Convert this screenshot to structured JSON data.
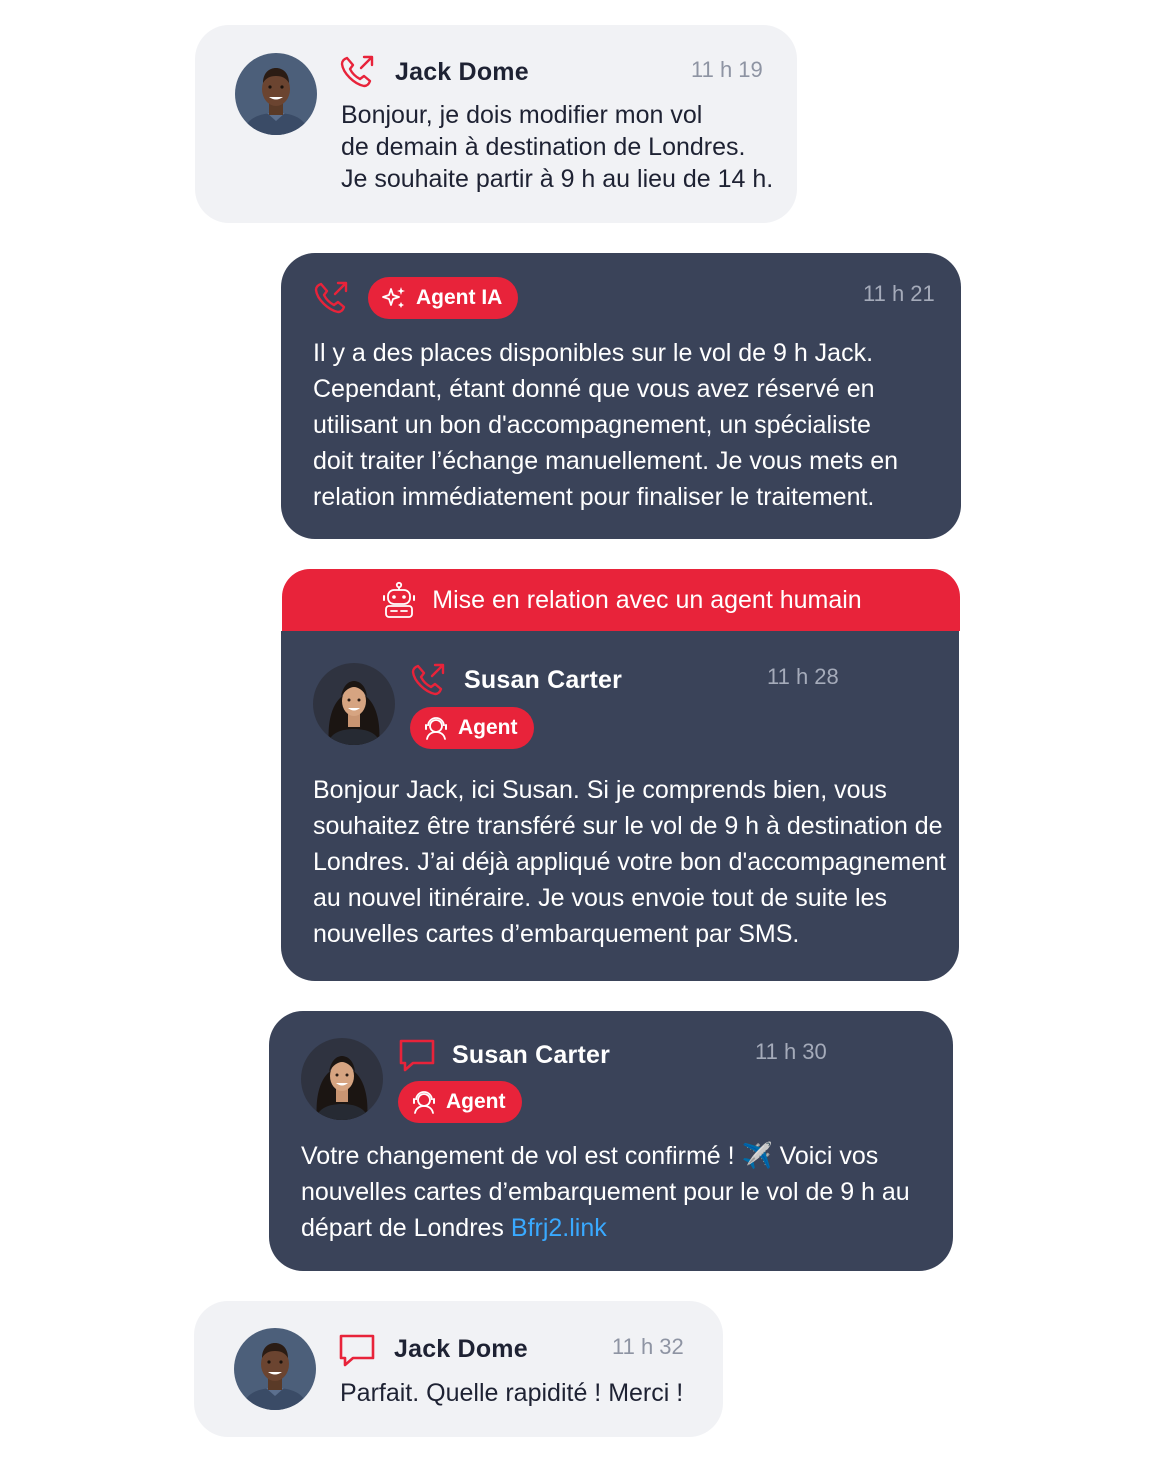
{
  "conversation": {
    "messages": [
      {
        "sender": "Jack Dome",
        "channel_icon": "phone-call-icon",
        "time": "11 h 19",
        "lines": [
          "Bonjour, je dois modifier mon vol",
          "de demain à destination de Londres.",
          "Je souhaite partir à 9 h au lieu de 14 h."
        ]
      },
      {
        "channel_icon": "phone-call-icon",
        "badge": "Agent IA",
        "badge_icon": "sparkles-icon",
        "time": "11 h 21",
        "lines": [
          "Il y a des places disponibles sur le vol de 9 h Jack.",
          "Cependant, étant donné que vous avez réservé en",
          "utilisant un bon d'accompagnement, un spécialiste",
          "doit traiter l’échange manuellement. Je vous mets en",
          "relation immédiatement pour finaliser le traitement."
        ]
      },
      {
        "banner": "Mise en relation avec un agent humain",
        "banner_icon": "robot-icon",
        "sender": "Susan Carter",
        "channel_icon": "phone-call-icon",
        "badge": "Agent",
        "badge_icon": "headset-agent-icon",
        "time": "11 h 28",
        "lines": [
          "Bonjour Jack, ici Susan. Si je comprends bien, vous",
          "souhaitez être transféré sur le vol de 9 h à destination de",
          "Londres. J’ai déjà appliqué votre bon d'accompagnement",
          "au nouvel itinéraire. Je vous envoie tout de suite les",
          "nouvelles cartes d’embarquement par SMS."
        ]
      },
      {
        "sender": "Susan Carter",
        "channel_icon": "chat-bubble-icon",
        "badge": "Agent",
        "badge_icon": "headset-agent-icon",
        "time": "11 h 30",
        "lines": [
          "Votre changement de vol est confirmé ! ✈️ Voici vos",
          "nouvelles cartes d’embarquement pour le vol de 9 h au",
          "départ de Londres "
        ],
        "link": "Bfrj2.link"
      },
      {
        "sender": "Jack Dome",
        "channel_icon": "chat-bubble-icon",
        "time": "11 h 32",
        "lines": [
          "Parfait. Quelle rapidité ! Merci !"
        ]
      }
    ]
  },
  "colors": {
    "accent_red": "#e8233a",
    "dark_card": "#3a4359",
    "light_card": "#f1f2f5",
    "link": "#39a9ff"
  }
}
